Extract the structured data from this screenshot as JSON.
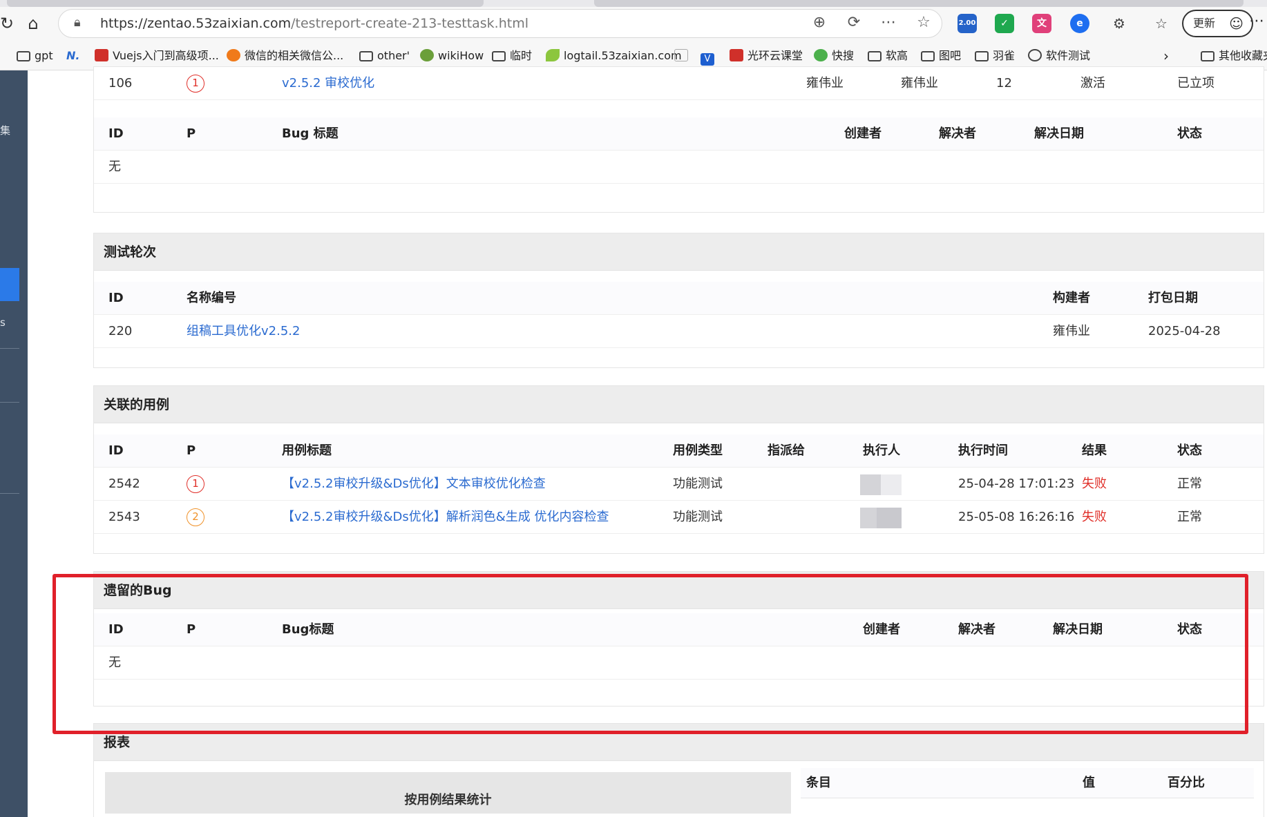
{
  "browser": {
    "url_host": "https://zentao.53zaixian.com",
    "url_path": "/testreport-create-213-testtask.html",
    "update_button": "更新",
    "ext_badge": "2.00",
    "bookmarks": [
      "gpt",
      "Vuejs入门到高级项...",
      "微信的相关微信公...",
      "other'",
      "wikiHow",
      "临时",
      "logtail.53zaixian.com",
      "光环云课堂",
      "快搜",
      "软高",
      "图吧",
      "羽雀",
      "软件测试",
      "其他收藏夹"
    ]
  },
  "sidebar": {
    "char1": "集",
    "char2": "s"
  },
  "bug_section_top": {
    "build_row": {
      "id": "106",
      "pri": "1",
      "title": "v2.5.2 审校优化",
      "creator": "雍伟业",
      "owner": "雍伟业",
      "count": "12",
      "stage": "激活",
      "status": "已立项"
    },
    "headers": [
      "ID",
      "P",
      "Bug 标题",
      "创建者",
      "解决者",
      "解决日期",
      "状态"
    ],
    "empty": "无"
  },
  "test_rounds": {
    "title": "测试轮次",
    "headers": [
      "ID",
      "名称编号",
      "构建者",
      "打包日期"
    ],
    "rows": [
      {
        "id": "220",
        "name": "组稿工具优化v2.5.2",
        "builder": "雍伟业",
        "date": "2025-04-28"
      }
    ]
  },
  "cases": {
    "title": "关联的用例",
    "headers": [
      "ID",
      "P",
      "用例标题",
      "用例类型",
      "指派给",
      "执行人",
      "执行时间",
      "结果",
      "状态"
    ],
    "rows": [
      {
        "id": "2542",
        "pri": "1",
        "title": "【v2.5.2审校升级&Ds优化】文本审校优化检查",
        "type": "功能测试",
        "time": "25-04-28 17:01:23",
        "result": "失败",
        "status": "正常"
      },
      {
        "id": "2543",
        "pri": "2",
        "title": "【v2.5.2审校升级&Ds优化】解析润色&生成 优化内容检查",
        "type": "功能测试",
        "time": "25-05-08 16:26:16",
        "result": "失败",
        "status": "正常"
      }
    ]
  },
  "remaining_bugs": {
    "title": "遗留的Bug",
    "headers": [
      "ID",
      "P",
      "Bug标题",
      "创建者",
      "解决者",
      "解决日期",
      "状态"
    ],
    "empty": "无"
  },
  "report": {
    "title": "报表",
    "chart_caption": "按用例结果统计",
    "headers": [
      "条目",
      "值",
      "百分比"
    ]
  },
  "colors": {
    "accent": "#2b7ae8",
    "link": "#2b6bd0",
    "fail": "#e0302a",
    "highlight": "#e0202a"
  }
}
